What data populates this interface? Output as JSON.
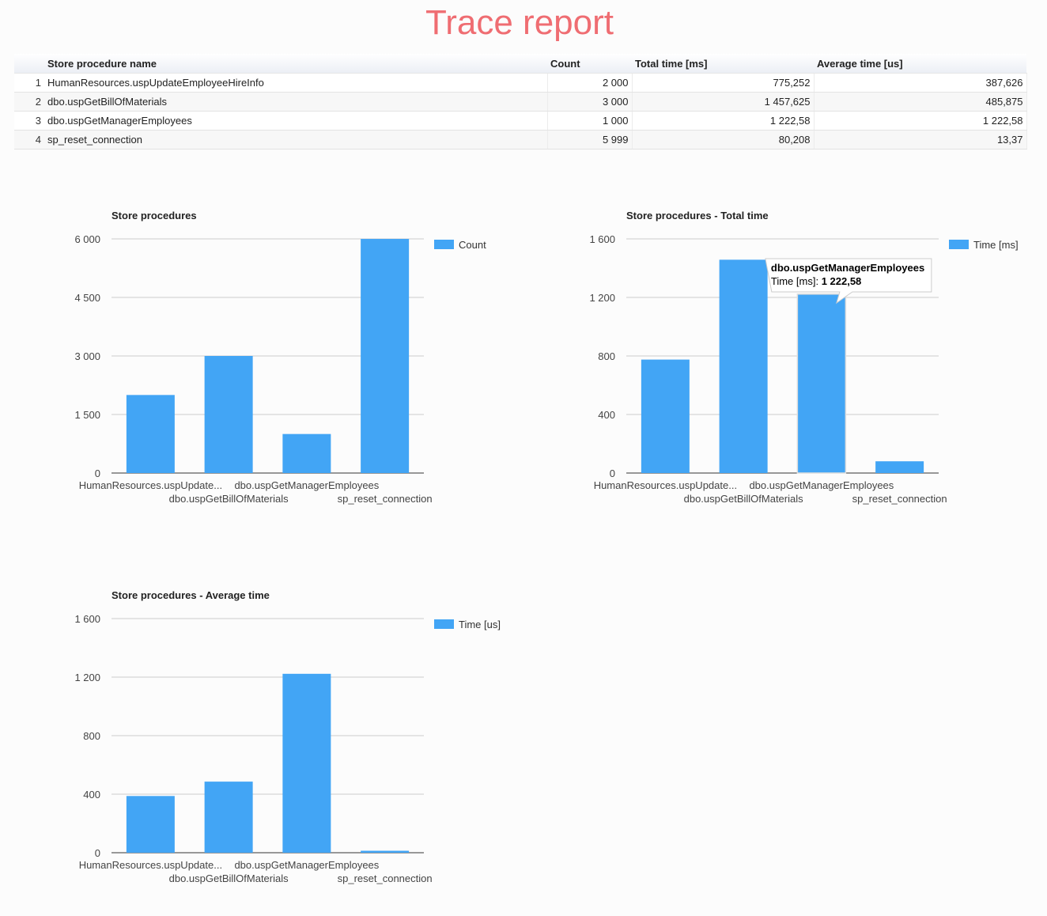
{
  "page": {
    "title": "Trace report"
  },
  "table": {
    "headers": [
      "",
      "Store procedure name",
      "Count",
      "Total time [ms]",
      "Average time [us]"
    ],
    "rows": [
      [
        "1",
        "HumanResources.uspUpdateEmployeeHireInfo",
        "2 000",
        "775,252",
        "387,626"
      ],
      [
        "2",
        "dbo.uspGetBillOfMaterials",
        "3 000",
        "1 457,625",
        "485,875"
      ],
      [
        "3",
        "dbo.uspGetManagerEmployees",
        "1 000",
        "1 222,58",
        "1 222,58"
      ],
      [
        "4",
        "sp_reset_connection",
        "5 999",
        "80,208",
        "13,37"
      ]
    ]
  },
  "chart_data": [
    {
      "type": "bar",
      "title": "Store procedures",
      "categories": [
        "HumanResources.uspUpdate...",
        "dbo.uspGetBillOfMaterials",
        "dbo.uspGetManagerEmployees",
        "sp_reset_connection"
      ],
      "series": [
        {
          "name": "Count",
          "values": [
            2000,
            3000,
            1000,
            5999
          ]
        }
      ],
      "yticks": [
        0,
        1500,
        3000,
        4500,
        6000
      ],
      "ytick_labels": [
        "0",
        "1 500",
        "3 000",
        "4 500",
        "6 000"
      ],
      "ylim": [
        0,
        6000
      ],
      "grid": true,
      "legend": "right",
      "color": "#42a5f5"
    },
    {
      "type": "bar",
      "title": "Store procedures - Total time",
      "categories": [
        "HumanResources.uspUpdate...",
        "dbo.uspGetBillOfMaterials",
        "dbo.uspGetManagerEmployees",
        "sp_reset_connection"
      ],
      "series": [
        {
          "name": "Time [ms]",
          "values": [
            775.252,
            1457.625,
            1222.58,
            80.208
          ]
        }
      ],
      "yticks": [
        0,
        400,
        800,
        1200,
        1600
      ],
      "ytick_labels": [
        "0",
        "400",
        "800",
        "1 200",
        "1 600"
      ],
      "ylim": [
        0,
        1600
      ],
      "grid": true,
      "legend": "right",
      "color": "#42a5f5",
      "tooltip": {
        "category_index": 2,
        "title": "dbo.uspGetManagerEmployees",
        "label": "Time [ms]",
        "value": "1 222,58"
      }
    },
    {
      "type": "bar",
      "title": "Store procedures - Average time",
      "categories": [
        "HumanResources.uspUpdate...",
        "dbo.uspGetBillOfMaterials",
        "dbo.uspGetManagerEmployees",
        "sp_reset_connection"
      ],
      "series": [
        {
          "name": "Time [us]",
          "values": [
            387.626,
            485.875,
            1222.58,
            13.37
          ]
        }
      ],
      "yticks": [
        0,
        400,
        800,
        1200,
        1600
      ],
      "ytick_labels": [
        "0",
        "400",
        "800",
        "1 200",
        "1 600"
      ],
      "ylim": [
        0,
        1600
      ],
      "grid": true,
      "legend": "right",
      "color": "#42a5f5"
    }
  ]
}
